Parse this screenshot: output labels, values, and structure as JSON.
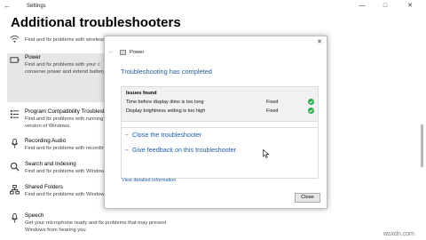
{
  "window": {
    "app_title": "Settings",
    "back_icon": "back-arrow-icon",
    "controls": {
      "minimize": "—",
      "maximize": "□",
      "close": "✕"
    }
  },
  "page": {
    "heading": "Additional troubleshooters"
  },
  "troubleshooters": [
    {
      "icon": "network-adapter-icon",
      "title": "",
      "description": "Find and fix problems with wireless"
    },
    {
      "icon": "power-icon",
      "title": "Power",
      "description_lines": [
        "Find and fix problems with your c",
        "conserve power and extend battery"
      ],
      "selected": true
    },
    {
      "icon": "program-compat-icon",
      "title": "Program Compatibility Troublesho",
      "description_lines": [
        "Find and fix problems with running",
        "version of Windows."
      ]
    },
    {
      "icon": "microphone-icon",
      "title": "Recording Audio",
      "description": "Find and fix problems with recording"
    },
    {
      "icon": "search-icon",
      "title": "Search and Indexing",
      "description": "Find and fix problems with Windows"
    },
    {
      "icon": "shared-folders-icon",
      "title": "Shared Folders",
      "description": "Find and fix problems with Windows"
    },
    {
      "icon": "speech-icon",
      "title": "Speech",
      "description_lines": [
        "Get your microphone ready and fix problems that may prevent",
        "Windows from hearing you"
      ]
    }
  ],
  "dialog": {
    "app_title": "Power",
    "heading": "Troubleshooting has completed",
    "issues_label": "Issues found",
    "issues": [
      {
        "text": "Time before display dims is too long",
        "status": "Fixed"
      },
      {
        "text": "Display brightness setting is too high",
        "status": "Fixed"
      }
    ],
    "close_troubleshooter": "Close the troubleshooter",
    "give_feedback": "Give feedback on this troubleshooter",
    "view_details": "View detailed information",
    "close_button": "Close",
    "link_arrow": "→",
    "close_x": "✕",
    "back_arrow": "←"
  },
  "watermark": "wsxdn.com",
  "colors": {
    "link": "#1f5da8",
    "check": "#2fa84f",
    "selected": "#e6e6e6"
  }
}
